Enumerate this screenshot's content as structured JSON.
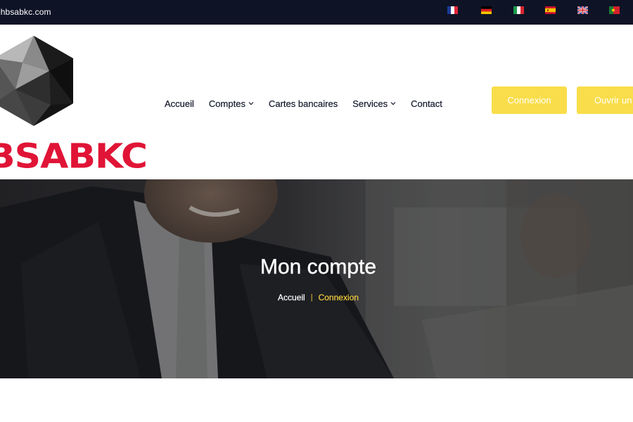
{
  "topbar": {
    "email": "ehbsabkc.com",
    "languages": [
      {
        "code": "fr",
        "icon": "flag-france-icon"
      },
      {
        "code": "de",
        "icon": "flag-germany-icon"
      },
      {
        "code": "it",
        "icon": "flag-italy-icon"
      },
      {
        "code": "es",
        "icon": "flag-spain-icon"
      },
      {
        "code": "en",
        "icon": "flag-uk-icon"
      },
      {
        "code": "pt",
        "icon": "flag-portugal-icon"
      }
    ]
  },
  "logo": {
    "text": "BSABKC",
    "icon": "dark-polyhedron-logo-icon",
    "text_color": "#e01436"
  },
  "nav": {
    "items": [
      {
        "label": "Accueil",
        "has_dropdown": false
      },
      {
        "label": "Comptes",
        "has_dropdown": true
      },
      {
        "label": "Cartes bancaires",
        "has_dropdown": false
      },
      {
        "label": "Services",
        "has_dropdown": true
      },
      {
        "label": "Contact",
        "has_dropdown": false
      }
    ]
  },
  "buttons": {
    "login": "Connexion",
    "open_account": "Ouvrir un compte"
  },
  "hero": {
    "title": "Mon compte",
    "breadcrumb": {
      "home": "Accueil",
      "separator": "|",
      "current": "Connexion"
    }
  },
  "colors": {
    "topbar_bg": "#0e1326",
    "accent_yellow": "#f9dd4a",
    "breadcrumb_current": "#f4cf3f",
    "nav_text": "#141a2b"
  }
}
